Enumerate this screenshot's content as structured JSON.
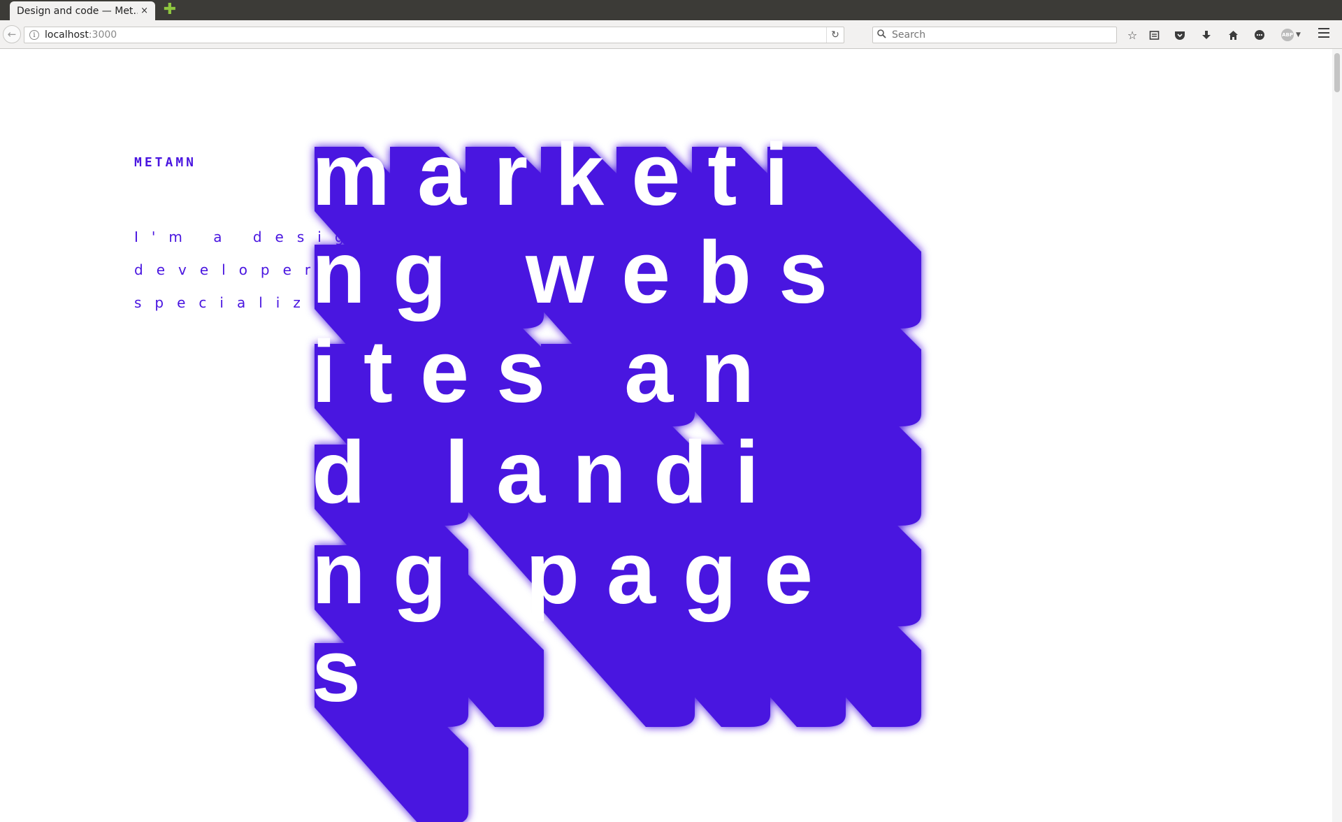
{
  "browser": {
    "tab_title": "Design and code — Met…",
    "tab_close": "×",
    "new_tab": "✚",
    "url_host": "localhost",
    "url_port": ":3000",
    "search_placeholder": "Search",
    "abp_label": "ABP"
  },
  "site": {
    "brand": "METAMN",
    "intro": "I'm a designer & developer specialized in",
    "hero_lines": [
      "marketi",
      "ng webs",
      "ites an",
      "d landi",
      "ng page",
      "s"
    ],
    "accent_color": "#4a16e0",
    "hero_text_color": "#ffffff"
  }
}
